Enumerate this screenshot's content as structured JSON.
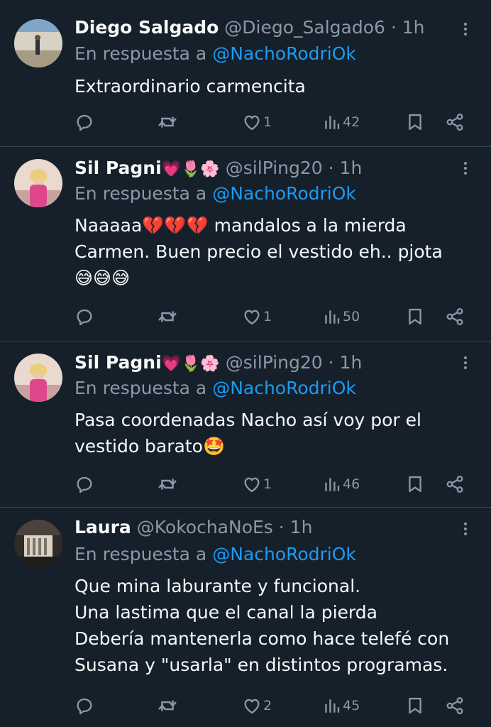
{
  "colors": {
    "background": "#15202b",
    "text_primary": "#f7f9f9",
    "text_secondary": "#8b98a5",
    "mention": "#1d9bf0",
    "divider": "#38444d"
  },
  "icons": {
    "more": "more-vertical-icon",
    "reply": "reply-icon",
    "retweet": "retweet-icon",
    "like": "heart-icon",
    "views": "views-icon",
    "bookmark": "bookmark-icon",
    "share": "share-icon"
  },
  "replies": [
    {
      "name": "Diego Salgado",
      "name_emoji": "",
      "handle": "@Diego_Salgado6",
      "separator": " · ",
      "time": "1h",
      "reply_prefix": "En respuesta a ",
      "reply_to": "@NachoRodriOk",
      "text": "Extraordinario carmencita",
      "stats": {
        "replies": "",
        "retweets": "",
        "likes": "1",
        "views": "42"
      }
    },
    {
      "name": "Sil Pagni",
      "name_emoji": "💗🌷🌸",
      "handle": "@silPing20",
      "separator": " · ",
      "time": "1h",
      "reply_prefix": "En respuesta a ",
      "reply_to": "@NachoRodriOk",
      "text": "Naaaaa💔💔💔 mandalos a la mierda\nCarmen. Buen precio el vestido eh.. pjota\n😅😅😅",
      "stats": {
        "replies": "",
        "retweets": "",
        "likes": "1",
        "views": "50"
      }
    },
    {
      "name": "Sil Pagni",
      "name_emoji": "💗🌷🌸",
      "handle": "@silPing20",
      "separator": " · ",
      "time": "1h",
      "reply_prefix": "En respuesta a ",
      "reply_to": "@NachoRodriOk",
      "text": "Pasa coordenadas Nacho así voy por el\nvestido barato🤩",
      "stats": {
        "replies": "",
        "retweets": "",
        "likes": "1",
        "views": "46"
      }
    },
    {
      "name": "Laura",
      "name_emoji": "",
      "handle": "@KokochaNoEs",
      "separator": " · ",
      "time": "1h",
      "reply_prefix": "En respuesta a ",
      "reply_to": "@NachoRodriOk",
      "text": "Que mina laburante y funcional.\nUna lastima que el canal la pierda\nDebería mantenerla como hace telefé con\nSusana y \"usarla\" en distintos programas.",
      "stats": {
        "replies": "",
        "retweets": "",
        "likes": "2",
        "views": "45"
      }
    }
  ]
}
